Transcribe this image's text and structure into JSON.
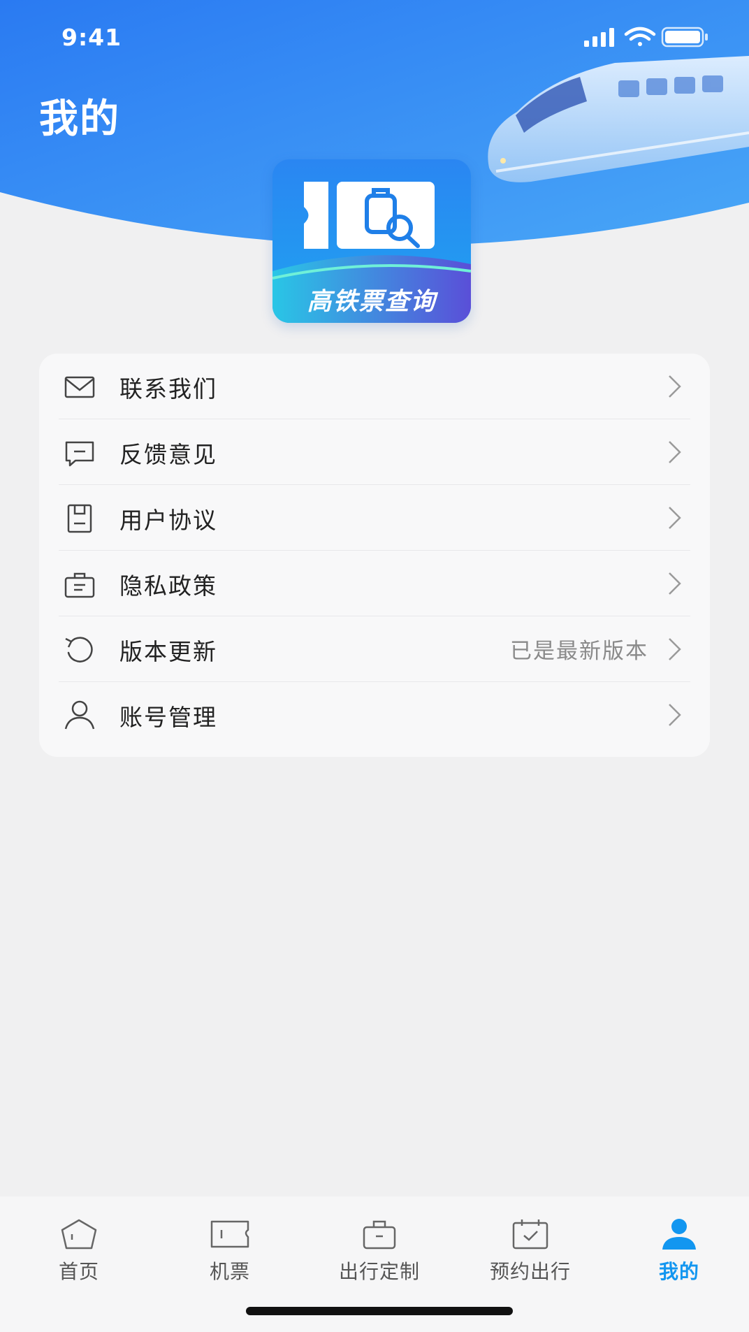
{
  "status_bar": {
    "time": "9:41"
  },
  "header": {
    "title": "我的"
  },
  "logo": {
    "text": "高铁票查询"
  },
  "menu": [
    {
      "label": "联系我们",
      "icon": "mail-icon",
      "value": ""
    },
    {
      "label": "反馈意见",
      "icon": "message-icon",
      "value": ""
    },
    {
      "label": "用户协议",
      "icon": "document-icon",
      "value": ""
    },
    {
      "label": "隐私政策",
      "icon": "briefcase-icon",
      "value": ""
    },
    {
      "label": "版本更新",
      "icon": "refresh-icon",
      "value": "已是最新版本"
    },
    {
      "label": "账号管理",
      "icon": "user-icon",
      "value": ""
    }
  ],
  "tabbar": {
    "active": "我的",
    "items": [
      {
        "label": "首页",
        "icon": "home-icon"
      },
      {
        "label": "机票",
        "icon": "ticket-icon"
      },
      {
        "label": "出行定制",
        "icon": "luggage-icon"
      },
      {
        "label": "预约出行",
        "icon": "calendar-check-icon"
      },
      {
        "label": "我的",
        "icon": "profile-icon"
      }
    ]
  },
  "colors": {
    "header_blue": "#2f7ff5",
    "accent": "#1296f0",
    "background": "#f0f0f1",
    "card": "#f8f8f9"
  }
}
